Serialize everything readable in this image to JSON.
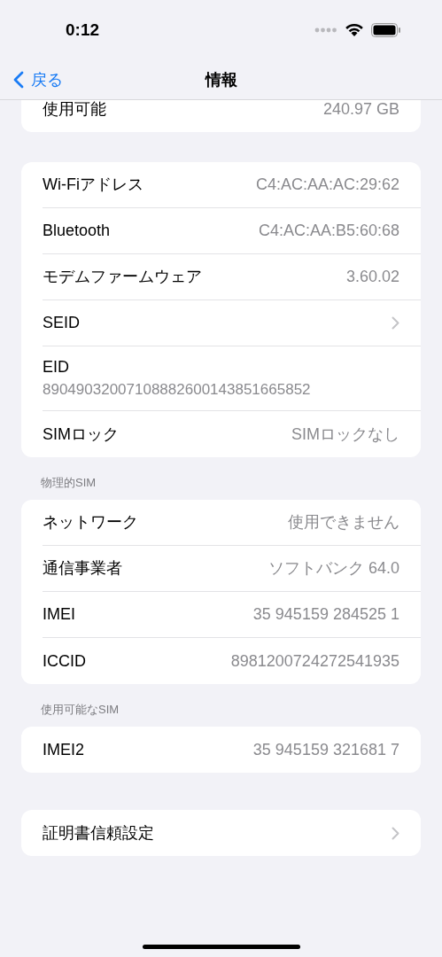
{
  "status_bar": {
    "time": "0:12"
  },
  "nav": {
    "back": "戻る",
    "title": "情報"
  },
  "sections": [
    {
      "rows": [
        {
          "kind": "value",
          "label": "使用可能",
          "value": "240.97 GB"
        }
      ]
    },
    {
      "rows": [
        {
          "kind": "value",
          "label": "Wi-Fiアドレス",
          "value": "C4:AC:AA:AC:29:62"
        },
        {
          "kind": "value",
          "label": "Bluetooth",
          "value": "C4:AC:AA:B5:60:68"
        },
        {
          "kind": "value",
          "label": "モデムファームウェア",
          "value": "3.60.02"
        },
        {
          "kind": "chevron",
          "label": "SEID"
        },
        {
          "kind": "stacked",
          "label": "EID",
          "value": "89049032007108882600143851665852"
        },
        {
          "kind": "value",
          "label": "SIMロック",
          "value": "SIMロックなし"
        }
      ]
    },
    {
      "header": "物理的SIM",
      "rows": [
        {
          "kind": "value",
          "label": "ネットワーク",
          "value": "使用できません"
        },
        {
          "kind": "value",
          "label": "通信事業者",
          "value": "ソフトバンク 64.0"
        },
        {
          "kind": "value",
          "label": "IMEI",
          "value": "35 945159 284525 1"
        },
        {
          "kind": "value",
          "label": "ICCID",
          "value": "8981200724272541935"
        }
      ]
    },
    {
      "header": "使用可能なSIM",
      "rows": [
        {
          "kind": "value",
          "label": "IMEI2",
          "value": "35 945159 321681 7"
        }
      ]
    },
    {
      "rows": [
        {
          "kind": "chevron",
          "label": "証明書信頼設定"
        }
      ]
    }
  ]
}
